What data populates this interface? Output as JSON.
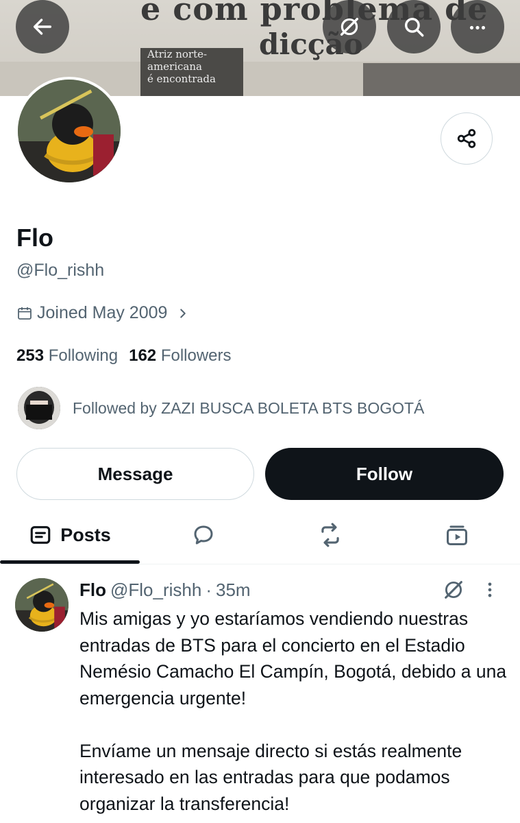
{
  "banner": {
    "headline_line1": "e com problema de",
    "headline_line2": "dicção",
    "caption": [
      "Atriz norte-",
      "americana",
      "é encontrada"
    ]
  },
  "header": {
    "back_icon": "arrow-left-icon",
    "grok_icon": "grok-icon",
    "search_icon": "search-icon",
    "more_icon": "more-horizontal-icon"
  },
  "profile": {
    "name": "Flo",
    "handle": "@Flo_rishh",
    "joined": "Joined May 2009",
    "following_count": "253",
    "following_label": "Following",
    "followers_count": "162",
    "followers_label": "Followers",
    "followed_by": "Followed by ZAZI BUSCA BOLETA BTS BOGOTÁ"
  },
  "actions": {
    "message_label": "Message",
    "follow_label": "Follow"
  },
  "tabs": {
    "posts_label": "Posts"
  },
  "post": {
    "author": "Flo",
    "handle": "@Flo_rishh",
    "separator": "·",
    "time": "35m",
    "paragraph1": "Mis amigas y yo estaríamos vendiendo nuestras entradas de BTS para el concierto en el Estadio Nemésio Camacho El Campín, Bogotá, debido a una emergencia urgente!",
    "paragraph2": "Envíame un mensaje directo si estás realmente interesado en las entradas para que podamos organizar la transferencia!"
  },
  "colors": {
    "text_primary": "#0f1419",
    "text_secondary": "#536471",
    "border": "#cfd9de",
    "follow_bg": "#0f1419"
  }
}
